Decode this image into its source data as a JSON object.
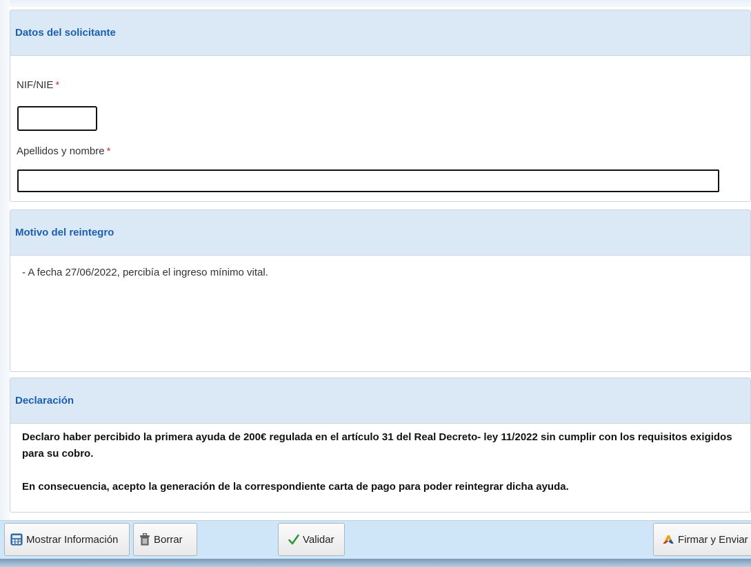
{
  "solicitante": {
    "title": "Datos del solicitante",
    "nif_label": "NIF/NIE",
    "nif_value": "",
    "nombre_label": "Apellidos y nombre",
    "nombre_value": "",
    "required_mark": "*"
  },
  "motivo": {
    "title": "Motivo del reintegro",
    "text": "- A fecha 27/06/2022, percibía el ingreso mínimo vital."
  },
  "declaracion": {
    "title": "Declaración",
    "line1": "Declaro haber percibido la primera ayuda de 200€ regulada en el artículo 31 del Real Decreto- ley 11/2022 sin cumplir con los requisitos exigidos para su cobro.",
    "line2": "En consecuencia, acepto la generación de la correspondiente carta de pago para poder reintegrar dicha ayuda."
  },
  "toolbar": {
    "mostrar_label": "Mostrar Información",
    "borrar_label": "Borrar",
    "validar_label": "Validar",
    "firmar_label": "Firmar y Enviar"
  },
  "colors": {
    "title": "#1a5fb4",
    "header_bg": "#dbe8f6",
    "toolbar_bg": "#cfe6f8",
    "required": "#dd3333",
    "check": "#2e9b2e"
  },
  "icons": {
    "mostrar": "calculator-icon",
    "borrar": "trash-icon",
    "validar": "checkmark-icon",
    "firmar": "signature-icon"
  }
}
